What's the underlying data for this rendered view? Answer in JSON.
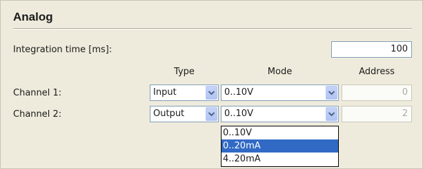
{
  "section": {
    "title": "Analog"
  },
  "integration": {
    "label": "Integration time [ms]:",
    "value": "100"
  },
  "columns": {
    "type": "Type",
    "mode": "Mode",
    "address": "Address"
  },
  "channels": [
    {
      "label": "Channel 1:",
      "type": "Input",
      "mode": "0..10V",
      "address": "0"
    },
    {
      "label": "Channel 2:",
      "type": "Output",
      "mode": "0..10V",
      "address": "2"
    }
  ],
  "mode_dropdown": {
    "options": [
      "0..10V",
      "0..20mA",
      "4..20mA"
    ],
    "highlighted": "0..20mA"
  },
  "colors": {
    "background": "#efebdc",
    "selection": "#316ac5",
    "combo_arrow": "#4d6185"
  }
}
